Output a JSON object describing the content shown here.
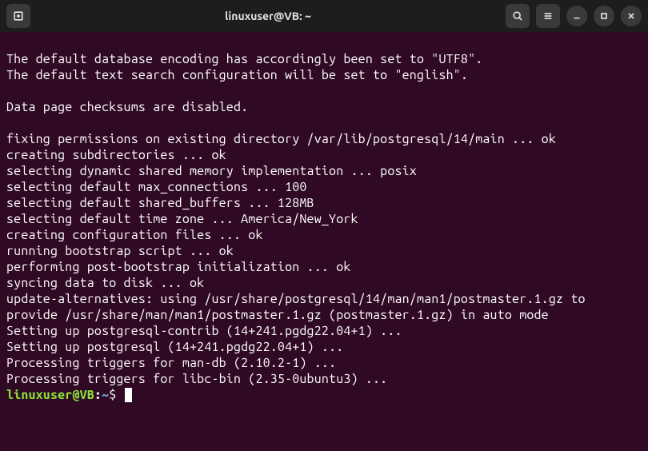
{
  "window": {
    "title": "linuxuser@VB: ~"
  },
  "output": {
    "lines": [
      "The default database encoding has accordingly been set to \"UTF8\".",
      "The default text search configuration will be set to \"english\".",
      "",
      "Data page checksums are disabled.",
      "",
      "fixing permissions on existing directory /var/lib/postgresql/14/main ... ok",
      "creating subdirectories ... ok",
      "selecting dynamic shared memory implementation ... posix",
      "selecting default max_connections ... 100",
      "selecting default shared_buffers ... 128MB",
      "selecting default time zone ... America/New_York",
      "creating configuration files ... ok",
      "running bootstrap script ... ok",
      "performing post-bootstrap initialization ... ok",
      "syncing data to disk ... ok",
      "update-alternatives: using /usr/share/postgresql/14/man/man1/postmaster.1.gz to provide /usr/share/man/man1/postmaster.1.gz (postmaster.1.gz) in auto mode",
      "Setting up postgresql-contrib (14+241.pgdg22.04+1) ...",
      "Setting up postgresql (14+241.pgdg22.04+1) ...",
      "Processing triggers for man-db (2.10.2-1) ...",
      "Processing triggers for libc-bin (2.35-0ubuntu3) ..."
    ]
  },
  "prompt": {
    "user_host": "linuxuser@VB",
    "colon": ":",
    "path": "~",
    "dollar": "$ "
  }
}
